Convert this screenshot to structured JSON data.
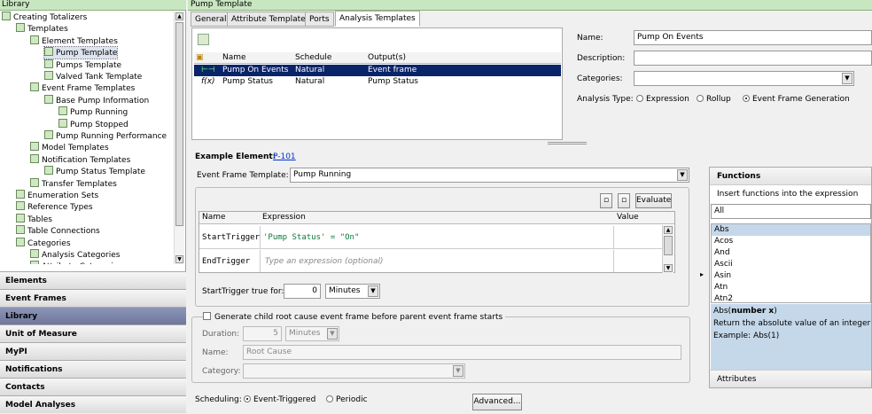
{
  "left": {
    "title": "Library",
    "tree": [
      {
        "label": "Creating Totalizers",
        "depth": 0
      },
      {
        "label": "Templates",
        "depth": 1
      },
      {
        "label": "Element Templates",
        "depth": 2
      },
      {
        "label": "Pump Template",
        "depth": 3
      },
      {
        "label": "Pumps Template",
        "depth": 3
      },
      {
        "label": "Valved Tank Template",
        "depth": 3
      },
      {
        "label": "Event Frame Templates",
        "depth": 2
      },
      {
        "label": "Base Pump Information",
        "depth": 3
      },
      {
        "label": "Pump Running",
        "depth": 4
      },
      {
        "label": "Pump Stopped",
        "depth": 4
      },
      {
        "label": "Pump Running Performance",
        "depth": 3
      },
      {
        "label": "Model Templates",
        "depth": 2
      },
      {
        "label": "Notification Templates",
        "depth": 2
      },
      {
        "label": "Pump Status Template",
        "depth": 3
      },
      {
        "label": "Transfer Templates",
        "depth": 2
      },
      {
        "label": "Enumeration Sets",
        "depth": 1
      },
      {
        "label": "Reference Types",
        "depth": 1
      },
      {
        "label": "Tables",
        "depth": 1
      },
      {
        "label": "Table Connections",
        "depth": 1
      },
      {
        "label": "Categories",
        "depth": 1
      },
      {
        "label": "Analysis Categories",
        "depth": 2
      },
      {
        "label": "Attribute Categories",
        "depth": 2
      }
    ],
    "nav": [
      "Elements",
      "Event Frames",
      "Library",
      "Unit of Measure",
      "MyPI",
      "Notifications",
      "Contacts",
      "Model Analyses"
    ]
  },
  "right": {
    "title": "Pump Template",
    "tabs": [
      "General",
      "Attribute Templates",
      "Ports",
      "Analysis Templates"
    ],
    "grid": {
      "headers": [
        "Name",
        "Schedule",
        "Output(s)"
      ],
      "rows": [
        {
          "name": "Pump On Events",
          "schedule": "Natural",
          "output": "Event frame"
        },
        {
          "name": "Pump Status",
          "schedule": "Natural",
          "output": "Pump Status"
        }
      ]
    },
    "props": {
      "name_label": "Name:",
      "name_value": "Pump On Events",
      "desc_label": "Description:",
      "desc_value": "",
      "cat_label": "Categories:",
      "cat_value": "",
      "type_label": "Analysis Type:",
      "types": [
        "Expression",
        "Rollup",
        "Event Frame Generation"
      ]
    },
    "example_label": "Example Element:",
    "example_value": "P-101",
    "ef_template_label": "Event Frame Template:",
    "ef_template_value": "Pump Running",
    "evaluate": "Evaluate",
    "expr_headers": [
      "Name",
      "Expression",
      "Value"
    ],
    "expr_rows": [
      {
        "name": "StartTrigger",
        "expr": "'Pump Status' = \"On\"",
        "placeholder": ""
      },
      {
        "name": "EndTrigger",
        "expr": "",
        "placeholder": "Type an expression (optional)"
      }
    ],
    "true_for_label": "StartTrigger true for:",
    "true_for_value": "0",
    "true_for_unit": "Minutes",
    "child_label": "Generate child root cause event frame before parent event frame starts",
    "duration_label": "Duration:",
    "duration_value": "5",
    "duration_unit": "Minutes",
    "child_name_label": "Name:",
    "child_name_value": "Root Cause",
    "child_cat_label": "Category:",
    "scheduling_label": "Scheduling:",
    "scheduling": [
      "Event-Triggered",
      "Periodic"
    ],
    "advanced": "Advanced..."
  },
  "functions": {
    "title": "Functions",
    "subtitle": "Insert functions into the expression",
    "filter": "All",
    "list": [
      "Abs",
      "Acos",
      "And",
      "Ascii",
      "Asin",
      "Atn",
      "Atn2"
    ],
    "sig_name": "Abs(",
    "sig_param": "number x",
    "sig_close": ")",
    "desc": "Return the absolute value of an integer or",
    "example": "Example: Abs(1)",
    "attributes": "Attributes"
  },
  "colors": {
    "selection": "#0a246a",
    "accent_green": "#c8e6c0"
  }
}
